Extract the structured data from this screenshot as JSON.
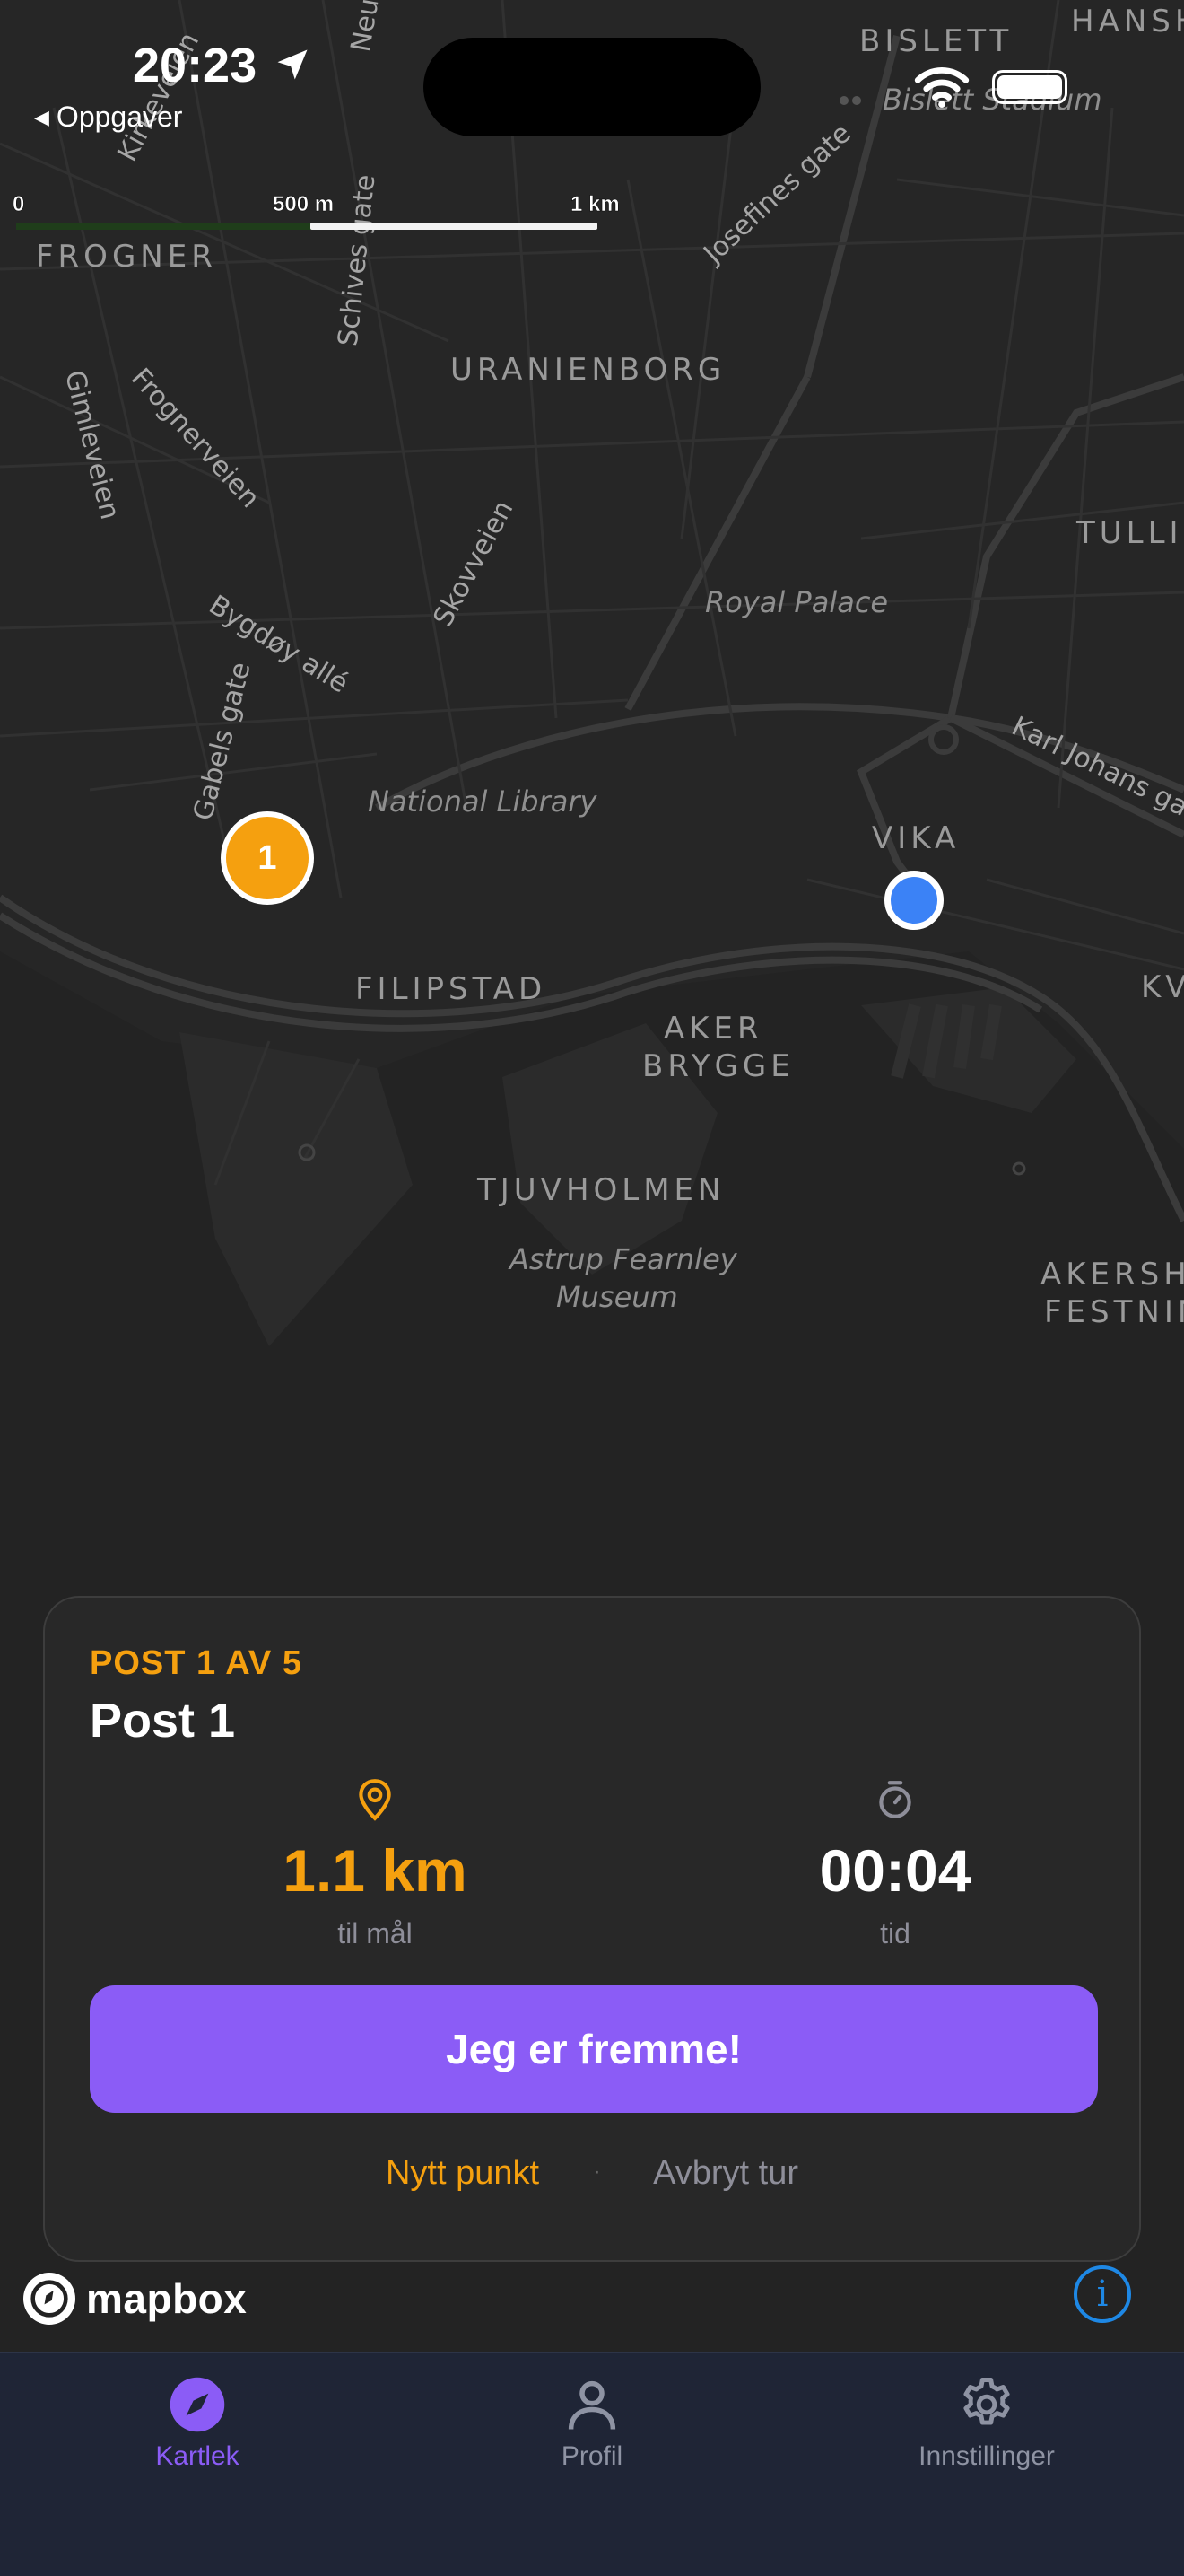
{
  "status_bar": {
    "time": "20:23",
    "back_label": "Oppgaver"
  },
  "map": {
    "scale": [
      "0",
      "500 m",
      "1 km"
    ],
    "districts": [
      "FROGNER",
      "URANIENBORG",
      "BISLETT",
      "HANSH",
      "TULLIN",
      "VIKA",
      "KV",
      "FILIPSTAD",
      "AKER",
      "BRYGGE",
      "TJUVHOLMEN",
      "AKERSHU",
      "FESTNING"
    ],
    "pois": [
      "Royal Palace",
      "National Library",
      "Astrup Fearnley",
      "Museum",
      "Bislett Stadium"
    ],
    "streets": [
      "Kirkeveien",
      "Neub",
      "Schives gate",
      "Josefines gate",
      "Gimleveien",
      "Frognerveien",
      "Skovveien",
      "Bygdøy allé",
      "Gabels gate",
      "Karl Johans gat"
    ],
    "post_marker_label": "1"
  },
  "card": {
    "eyebrow": "POST 1 AV 5",
    "title": "Post 1",
    "distance": {
      "value": "1.1 km",
      "label": "til mål"
    },
    "time": {
      "value": "00:04",
      "label": "tid"
    },
    "primary_button": "Jeg er fremme!",
    "secondary_link": "Nytt punkt",
    "separator": "·",
    "cancel_link": "Avbryt tur"
  },
  "attribution": {
    "logo_text": "mapbox",
    "info_glyph": "i"
  },
  "tabbar": {
    "tabs": [
      {
        "label": "Kartlek",
        "icon": "compass-icon",
        "active": true
      },
      {
        "label": "Profil",
        "icon": "person-icon",
        "active": false
      },
      {
        "label": "Innstillinger",
        "icon": "gear-icon",
        "active": false
      }
    ]
  },
  "colors": {
    "accent_orange": "#f5a00f",
    "accent_purple": "#8b5cf6",
    "user_blue": "#3b82f6",
    "tabbar_bg": "#1f2536",
    "map_bg": "#262626"
  },
  "icons": [
    "location-arrow-icon",
    "wifi-icon",
    "battery-icon",
    "pin-icon",
    "stopwatch-icon",
    "info-icon",
    "compass-icon",
    "person-icon",
    "gear-icon"
  ]
}
